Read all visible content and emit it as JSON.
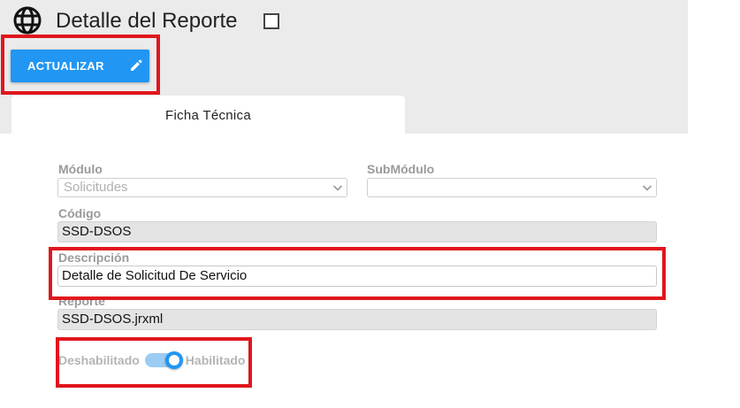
{
  "header": {
    "title": "Detalle del Reporte",
    "update_label": "ACTUALIZAR"
  },
  "tabs": [
    {
      "label": "Ficha Técnica"
    }
  ],
  "form": {
    "modulo": {
      "label": "Módulo",
      "value": "Solicitudes"
    },
    "submodulo": {
      "label": "SubMódulo",
      "value": ""
    },
    "codigo": {
      "label": "Código",
      "value": "SSD-DSOS"
    },
    "descripcion": {
      "label": "Descripción",
      "value": "Detalle de Solicitud De Servicio"
    },
    "reporte": {
      "label": "Reporte",
      "value": "SSD-DSOS.jrxml"
    },
    "estado": {
      "off_label": "Deshabilitado",
      "on_label": "Habilitado",
      "enabled": true
    }
  },
  "colors": {
    "accent": "#2196f3",
    "highlight": "#e0161d",
    "header_bg": "#ebebeb"
  },
  "icons": [
    "globe-icon",
    "maximize-icon",
    "pencil-icon",
    "chevron-down-icon"
  ]
}
